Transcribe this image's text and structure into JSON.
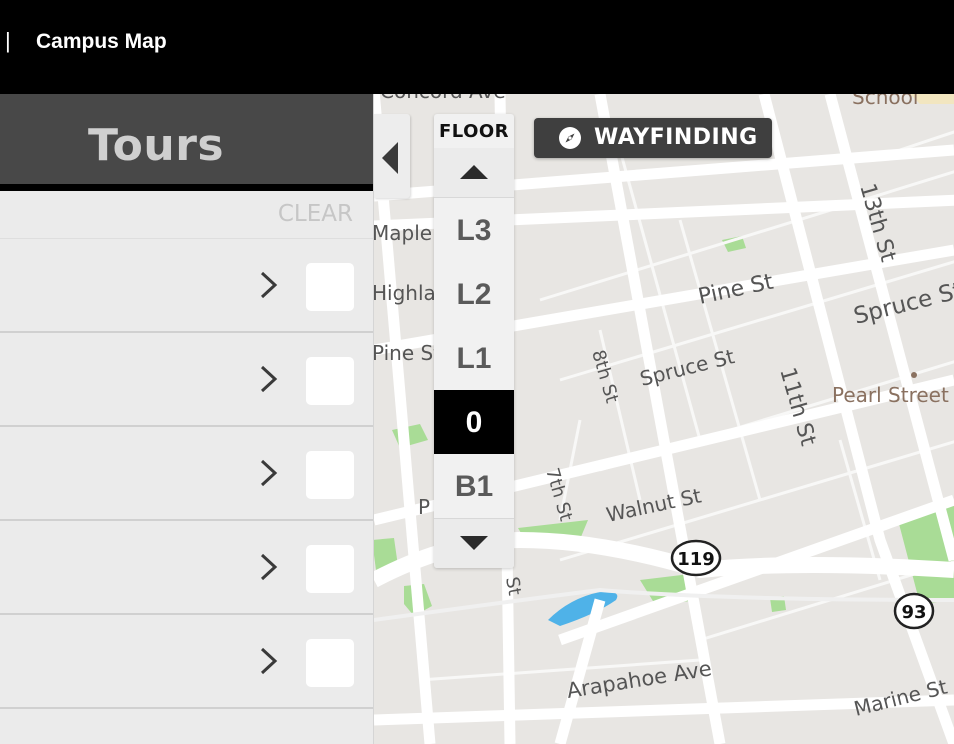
{
  "header": {
    "separator": "|",
    "title": "Campus Map"
  },
  "panel": {
    "title": "Tours",
    "clear_label": "CLEAR",
    "rows": [
      {
        "icon": "chevron-right-icon",
        "checked": false
      },
      {
        "icon": "chevron-right-icon",
        "checked": false
      },
      {
        "icon": "chevron-right-icon",
        "checked": false
      },
      {
        "icon": "chevron-right-icon",
        "checked": false
      },
      {
        "icon": "chevron-right-icon",
        "checked": false
      }
    ],
    "collapse_icon": "triangle-left-icon"
  },
  "floor_selector": {
    "label": "FLOOR",
    "up_icon": "triangle-up-icon",
    "down_icon": "triangle-down-icon",
    "levels": [
      "L3",
      "L2",
      "L1",
      "0",
      "B1"
    ],
    "selected": "0"
  },
  "wayfinding": {
    "label": "WAYFINDING",
    "icon": "compass-icon"
  },
  "map": {
    "labels": {
      "concord": "Concord Ave",
      "school": "School",
      "maple": "Maple",
      "highland": "Highlar",
      "pine_left": "Pine St",
      "pine": "Pine St",
      "spruce": "Spruce St",
      "spruce_right": "Spruce St",
      "thirteenth": "13th St",
      "eleventh": "11th St",
      "eighth": "8th St",
      "seventh": "7th St",
      "walnut": "Walnut St",
      "pearl": "Pearl Street",
      "arapahoe": "Arapahoe Ave",
      "marine": "Marine St",
      "p_frag": "P",
      "st_frag": "St",
      "hwy119": "119",
      "hwy93": "93"
    },
    "colors": {
      "land": "#e8e6e3",
      "road": "#ffffff",
      "park": "#a9dc96",
      "water": "#4fb2e8",
      "poi_label": "#8a7160"
    }
  }
}
